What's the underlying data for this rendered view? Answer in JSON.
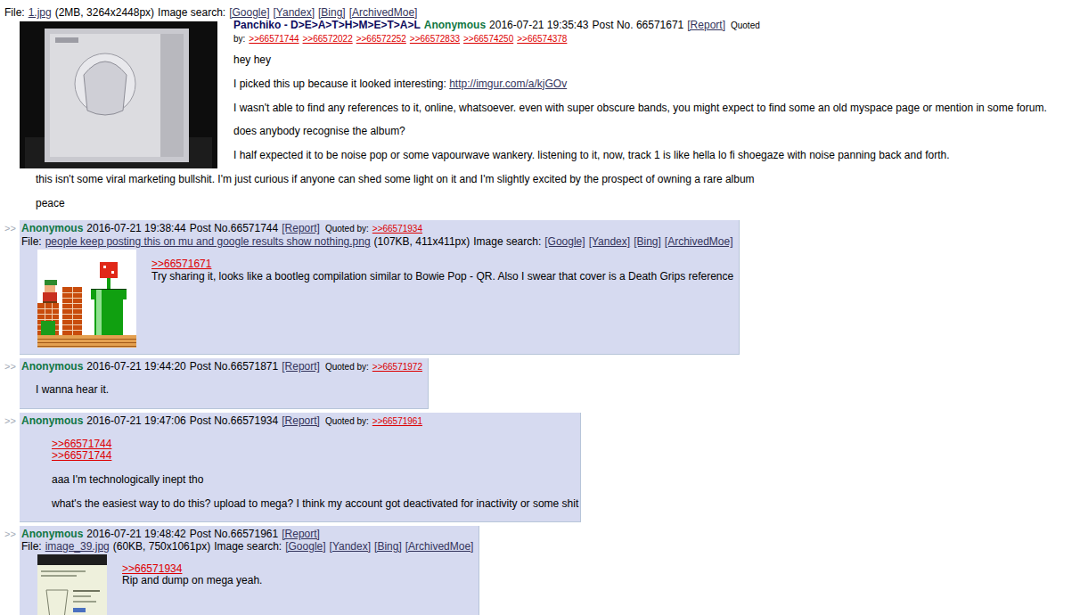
{
  "thread": {
    "op": {
      "file": {
        "label": "File:",
        "name": "1.jpg",
        "info": "(2MB, 3264x2448px)",
        "search_label": "Image search:",
        "search": [
          "[Google]",
          "[Yandex]",
          "[Bing]",
          "[ArchivedMoe]"
        ],
        "kind": "photo"
      },
      "subject": "Panchiko - D>E>A>T>H>M>E>T>A>L",
      "name": "Anonymous",
      "date": "2016-07-21 19:35:43",
      "post_no": "Post No. 66571671",
      "report": "[Report]",
      "quoted_by_label": "Quoted by:",
      "quoted_by": [
        ">>66571744",
        ">>66572022",
        ">>66572252",
        ">>66572833",
        ">>66574250",
        ">>66574378"
      ],
      "body": [
        [
          {
            "kind": "text",
            "text": "hey hey"
          }
        ],
        [],
        [
          {
            "kind": "text",
            "text": "I picked this up because it looked interesting: "
          },
          {
            "kind": "link",
            "text": "http://imgur.com/a/kjGOv"
          }
        ],
        [],
        [
          {
            "kind": "text",
            "text": "I wasn't able to find any references to it, online, whatsoever. even with super obscure bands, you might expect to find some an old myspace page or mention in some forum."
          }
        ],
        [],
        [
          {
            "kind": "text",
            "text": "does anybody recognise the album?"
          }
        ],
        [],
        [
          {
            "kind": "text",
            "text": "I half expected it to be noise pop or some vapourwave wankery. listening to it, now, track 1 is like hella lo fi shoegaze with noise panning back and forth."
          }
        ],
        [],
        [
          {
            "kind": "text",
            "text": "this isn't some viral marketing bullshit. I'm just curious if anyone can shed some light on it and I'm slightly excited by the prospect of owning a rare album"
          }
        ],
        [],
        [
          {
            "kind": "text",
            "text": "peace"
          }
        ]
      ]
    },
    "replies": [
      {
        "marker": ">>",
        "name": "Anonymous",
        "date": "2016-07-21 19:38:44",
        "post_no": "Post No.66571744",
        "report": "[Report]",
        "quoted_by_label": "Quoted by:",
        "quoted_by": [
          ">>66571934"
        ],
        "file": {
          "label": "File:",
          "name": "people keep posting this on mu and google results show nothing.png",
          "info": "(107KB, 411x411px)",
          "search_label": "Image search:",
          "search": [
            "[Google]",
            "[Yandex]",
            "[Bing]",
            "[ArchivedMoe]"
          ],
          "kind": "sprite"
        },
        "body": [
          [
            {
              "kind": "quote",
              "text": ">>66571671"
            }
          ],
          [
            {
              "kind": "text",
              "text": "Try sharing it, looks like a bootleg compilation similar to Bowie Pop - QR. Also I swear that cover is a Death Grips reference"
            }
          ]
        ]
      },
      {
        "marker": ">>",
        "name": "Anonymous",
        "date": "2016-07-21 19:44:20",
        "post_no": "Post No.66571871",
        "report": "[Report]",
        "quoted_by_label": "Quoted by:",
        "quoted_by": [
          ">>66571972"
        ],
        "body": [
          [
            {
              "kind": "text",
              "text": "I wanna hear it."
            }
          ]
        ]
      },
      {
        "marker": ">>",
        "name": "Anonymous",
        "date": "2016-07-21 19:47:06",
        "post_no": "Post No.66571934",
        "report": "[Report]",
        "quoted_by_label": "Quoted by:",
        "quoted_by": [
          ">>66571961"
        ],
        "body": [
          [
            {
              "kind": "quote",
              "text": ">>66571744"
            }
          ],
          [
            {
              "kind": "quote",
              "text": ">>66571744"
            }
          ],
          [],
          [
            {
              "kind": "text",
              "text": "aaa I'm technologically inept tho"
            }
          ],
          [],
          [
            {
              "kind": "text",
              "text": "what's the easiest way to do this? upload to mega? I think my account got deactivated for inactivity or some shit"
            }
          ]
        ]
      },
      {
        "marker": ">>",
        "name": "Anonymous",
        "date": "2016-07-21 19:48:42",
        "post_no": "Post No.66571961",
        "report": "[Report]",
        "file": {
          "label": "File:",
          "name": "image_39.jpg",
          "info": "(60KB, 750x1061px)",
          "search_label": "Image search:",
          "search": [
            "[Google]",
            "[Yandex]",
            "[Bing]",
            "[ArchivedMoe]"
          ],
          "kind": "scan"
        },
        "body": [
          [
            {
              "kind": "quote",
              "text": ">>66571934"
            }
          ],
          [
            {
              "kind": "text",
              "text": "Rip and dump on mega yeah."
            }
          ]
        ]
      }
    ]
  }
}
